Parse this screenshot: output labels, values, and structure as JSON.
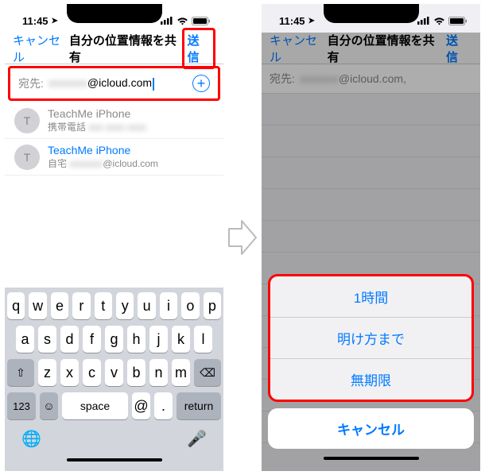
{
  "status": {
    "time": "11:45",
    "location_arrow": "↗"
  },
  "left": {
    "nav": {
      "cancel": "キャンセル",
      "title": "自分の位置情報を共有",
      "send": "送信"
    },
    "to": {
      "label": "宛先:",
      "value_blur": "xxxxxxx",
      "value_tail": "@icloud.com"
    },
    "contacts": [
      {
        "initial": "T",
        "name": "TeachMe iPhone",
        "sub_label": "携帯電話",
        "sub_blur": "xxx xxxx xxxx",
        "blue": false
      },
      {
        "initial": "T",
        "name": "TeachMe iPhone",
        "sub_label": "自宅",
        "sub_blur": "xxxxxxx",
        "sub_tail": "@icloud.com",
        "blue": true
      }
    ],
    "keyboard": {
      "row1": [
        "q",
        "w",
        "e",
        "r",
        "t",
        "y",
        "u",
        "i",
        "o",
        "p"
      ],
      "row2": [
        "a",
        "s",
        "d",
        "f",
        "g",
        "h",
        "j",
        "k",
        "l"
      ],
      "row3": [
        "z",
        "x",
        "c",
        "v",
        "b",
        "n",
        "m"
      ],
      "shift": "⇧",
      "back": "⌫",
      "nums": "123",
      "emoji": "☺",
      "space": "space",
      "at": "@",
      "dot": ".",
      "return": "return",
      "globe": "🌐",
      "mic": "🎤"
    }
  },
  "right": {
    "nav": {
      "cancel": "キャンセル",
      "title": "自分の位置情報を共有",
      "send": "送信"
    },
    "to": {
      "label": "宛先:",
      "value_blur": "xxxxxxx",
      "value_tail": "@icloud.com,"
    },
    "sheet": {
      "opt1": "1時間",
      "opt2": "明け方まで",
      "opt3": "無期限",
      "cancel": "キャンセル"
    }
  }
}
